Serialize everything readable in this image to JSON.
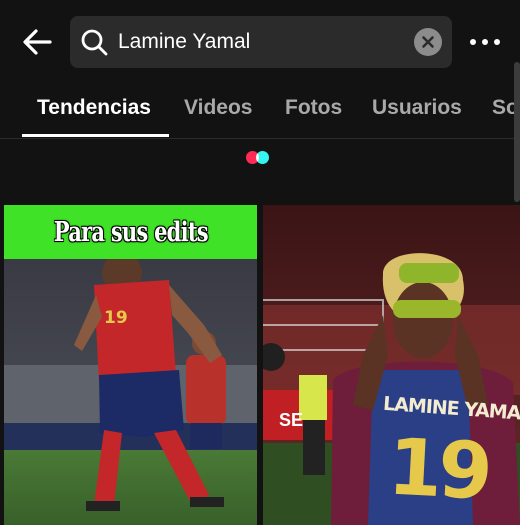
{
  "search": {
    "query": "Lamine Yamal",
    "icons": {
      "back": "arrow-left-icon",
      "search": "search-icon",
      "clear": "close-circle-icon",
      "more": "more-horizontal-icon"
    }
  },
  "tabs": [
    {
      "label": "Tendencias",
      "active": true
    },
    {
      "label": "Videos",
      "active": false
    },
    {
      "label": "Fotos",
      "active": false
    },
    {
      "label": "Usuarios",
      "active": false
    },
    {
      "label": "So",
      "active": false
    }
  ],
  "loader": {
    "colors": [
      "#fe2c55",
      "#25f4ee"
    ]
  },
  "results": [
    {
      "caption": "Para sus edits",
      "jersey_number": "19"
    },
    {
      "jersey_name": "LAMINE YAMAL",
      "jersey_number": "19",
      "sign_text": "SE"
    }
  ],
  "colors": {
    "background": "#121212",
    "caption_bar": "#3fe227",
    "tab_inactive": "#a9a9a9"
  }
}
